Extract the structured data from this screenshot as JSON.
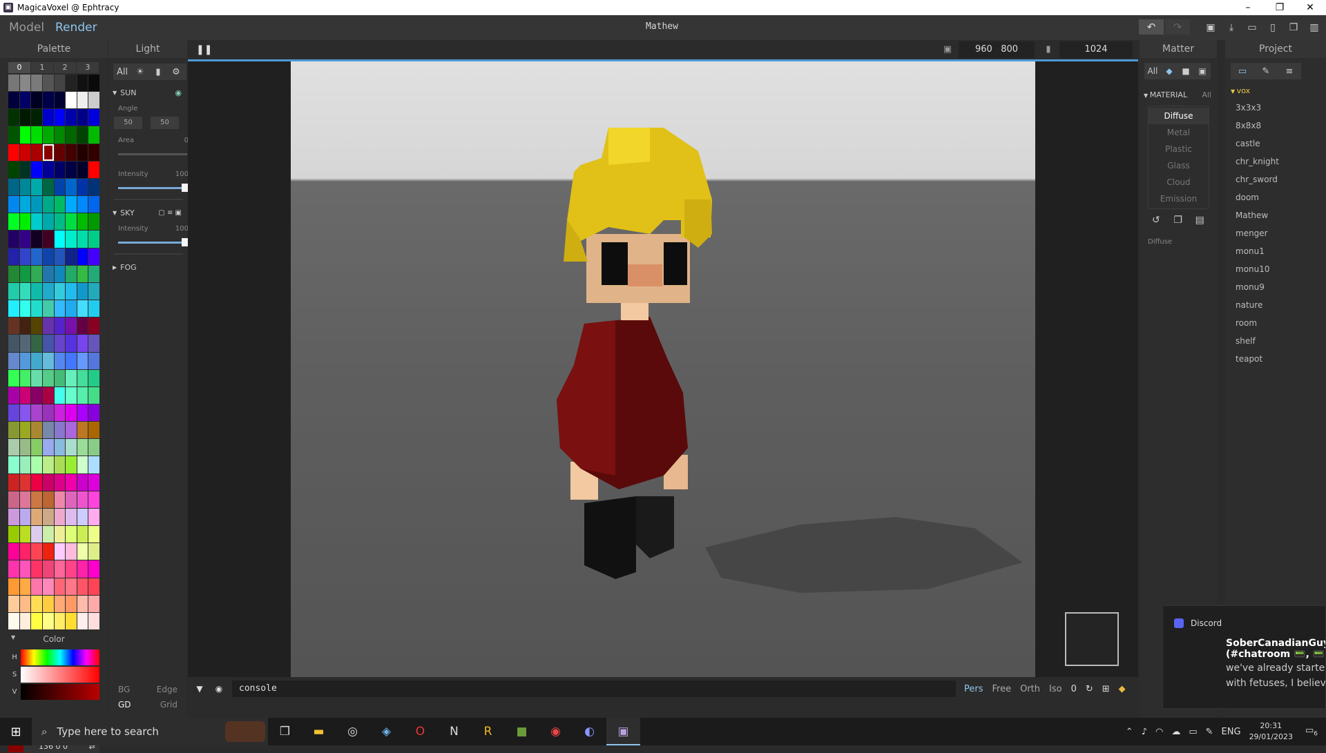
{
  "window": {
    "title": "MagicaVoxel @ Ephtracy",
    "app_icon": "magicavoxel-icon",
    "minimize": "–",
    "maximize": "❐",
    "close": "✕"
  },
  "menu": {
    "model": "Model",
    "render": "Render",
    "document_title": "Mathew"
  },
  "history": {
    "undo": "↶",
    "redo": "↷"
  },
  "palette": {
    "title": "Palette",
    "tabs": [
      "0",
      "1",
      "2",
      "3"
    ],
    "colors": [
      "#777777",
      "#888888",
      "#7a7a7a",
      "#555555",
      "#444444",
      "#222222",
      "#111111",
      "#0a0a0a",
      "#00003a",
      "#000066",
      "#000022",
      "#00004a",
      "#000033",
      "#ffffff",
      "#eeeeee",
      "#cccccc",
      "#003300",
      "#001a00",
      "#002200",
      "#0000cc",
      "#0000ff",
      "#0000aa",
      "#000088",
      "#0000dd",
      "#005500",
      "#00ff00",
      "#00dd00",
      "#00aa00",
      "#008800",
      "#006600",
      "#004400",
      "#00bb00",
      "#ff0000",
      "#cc0000",
      "#aa0000",
      "#880000",
      "#660000",
      "#440000",
      "#220000",
      "#330000",
      "#004400",
      "#003322",
      "#0000ff",
      "#000099",
      "#000066",
      "#000044",
      "#00002a",
      "#ff0000",
      "#006688",
      "#008899",
      "#00aaaa",
      "#006644",
      "#0044aa",
      "#0066cc",
      "#0033aa",
      "#003377",
      "#0088ee",
      "#00aadd",
      "#0099bb",
      "#00aa88",
      "#00bb66",
      "#00aaff",
      "#0088ff",
      "#0066ee",
      "#00ff22",
      "#00ee00",
      "#00cccc",
      "#00aaaa",
      "#00bb88",
      "#00dd44",
      "#00bb00",
      "#009900",
      "#220066",
      "#330088",
      "#110022",
      "#440022",
      "#00ffff",
      "#00eecc",
      "#00ddaa",
      "#00cc88",
      "#2222aa",
      "#3344cc",
      "#2266cc",
      "#1144aa",
      "#2255bb",
      "#112288",
      "#0000ff",
      "#4400ff",
      "#228833",
      "#119944",
      "#33aa55",
      "#2277aa",
      "#1188bb",
      "#22aa66",
      "#33bb44",
      "#22aa77",
      "#22ccaa",
      "#33ddbb",
      "#11bbaa",
      "#22aacc",
      "#33ccdd",
      "#22bbee",
      "#1199cc",
      "#22aabb",
      "#22eeff",
      "#33ffee",
      "#22ddcc",
      "#44ccaa",
      "#33bbff",
      "#22aaee",
      "#44ddff",
      "#22ccee",
      "#663322",
      "#442211",
      "#554400",
      "#6633aa",
      "#5522cc",
      "#7711aa",
      "#660044",
      "#880022",
      "#445566",
      "#556677",
      "#336644",
      "#4455aa",
      "#6644cc",
      "#5533dd",
      "#7744ee",
      "#6655bb",
      "#6688cc",
      "#5599dd",
      "#44aacc",
      "#66bbdd",
      "#5588ee",
      "#4477ff",
      "#6699ff",
      "#5577dd",
      "#33ff55",
      "#44ee66",
      "#66ddaa",
      "#55cc88",
      "#44bb77",
      "#66eebb",
      "#44dd99",
      "#22cc88",
      "#aa00aa",
      "#cc0077",
      "#880066",
      "#aa0044",
      "#44ffee",
      "#66ffcc",
      "#55eeaa",
      "#44dd88",
      "#6644dd",
      "#8855ee",
      "#aa44cc",
      "#9933bb",
      "#cc22dd",
      "#dd00ee",
      "#aa00ff",
      "#8800dd",
      "#889933",
      "#99aa22",
      "#aa8833",
      "#7788aa",
      "#8877cc",
      "#aa66dd",
      "#bb7722",
      "#aa6600",
      "#aaccaa",
      "#99bb88",
      "#88cc66",
      "#99aaee",
      "#88bbdd",
      "#aaddcc",
      "#99dd99",
      "#88cc88",
      "#88ffcc",
      "#99eebb",
      "#aaffaa",
      "#bbee88",
      "#aadd55",
      "#99ee33",
      "#ccffcc",
      "#aaddff",
      "#cc2222",
      "#dd3333",
      "#ee0044",
      "#cc0066",
      "#dd0088",
      "#ee00aa",
      "#cc00cc",
      "#dd00dd",
      "#cc6688",
      "#dd7799",
      "#cc7744",
      "#bb6633",
      "#ee88aa",
      "#dd66bb",
      "#ee55cc",
      "#ff44dd",
      "#cc99dd",
      "#bbaaee",
      "#ddaa77",
      "#ccaa88",
      "#eeaacc",
      "#ddbbee",
      "#ccccff",
      "#ffaaee",
      "#99cc00",
      "#bbdd22",
      "#ddccee",
      "#cceeaa",
      "#eeee99",
      "#ddff77",
      "#ccee55",
      "#eeff88",
      "#ff0099",
      "#ff2266",
      "#ff4455",
      "#ee2211",
      "#ffccff",
      "#ffbbdd",
      "#eeffaa",
      "#ddee88",
      "#ff33aa",
      "#ff55bb",
      "#ff3366",
      "#ee4477",
      "#ff6699",
      "#ff4488",
      "#ff22aa",
      "#ff00cc",
      "#ff9933",
      "#ffaa44",
      "#ff77aa",
      "#ff88bb",
      "#ff6677",
      "#ff7788",
      "#ff5566",
      "#ff4455",
      "#ffcc99",
      "#ffbb88",
      "#ffdd55",
      "#ffcc44",
      "#ffaa77",
      "#ff9966",
      "#ffbbaa",
      "#ffaaaa",
      "#fffaee",
      "#ffeedd",
      "#ffff44",
      "#ffff88",
      "#ffee66",
      "#ffdd33",
      "#ffeeee",
      "#ffdddd"
    ],
    "selected_index": 35
  },
  "color": {
    "title": "Color",
    "h": "H",
    "s": "S",
    "v": "V",
    "value": "136 0 0",
    "swap": "⇄"
  },
  "light": {
    "title": "Light",
    "icons": [
      "All",
      "☀",
      "▮",
      "⚙"
    ],
    "sun": {
      "label": "SUN",
      "angle_label": "Angle",
      "angle": [
        "50",
        "50"
      ],
      "area_label": "Area",
      "area": "0",
      "intensity_label": "Intensity",
      "intensity": "100"
    },
    "sky": {
      "label": "SKY",
      "intensity_label": "Intensity",
      "intensity": "100"
    },
    "fog": {
      "label": "FOG"
    }
  },
  "viewport": {
    "pause": "❚❚",
    "width": "960",
    "height": "800",
    "samples": "1024",
    "console_placeholder": "console",
    "views": [
      "Pers",
      "Free",
      "Orth",
      "Iso"
    ],
    "view_value": "0"
  },
  "bottom": {
    "bg": "BG",
    "edge": "Edge",
    "gd": "GD",
    "grid": "Grid"
  },
  "matter": {
    "title": "Matter",
    "icons": [
      "All",
      "◆",
      "■",
      "▣"
    ],
    "material_label": "MATERIAL",
    "material_filter": "All",
    "items": [
      "Diffuse",
      "Metal",
      "Plastic",
      "Glass",
      "Cloud",
      "Emission"
    ],
    "selected": "Diffuse",
    "sub_label": "Diffuse"
  },
  "project": {
    "title": "Project",
    "folder": "vox",
    "files": [
      "3x3x3",
      "8x8x8",
      "castle",
      "chr_knight",
      "chr_sword",
      "doom",
      "Mathew",
      "menger",
      "monu1",
      "monu10",
      "monu9",
      "nature",
      "room",
      "shelf",
      "teapot"
    ]
  },
  "toast": {
    "app": "Discord",
    "title": "SoberCanadianGuy (C",
    "line1": "(#chatroom 📟, 📟 Ma",
    "line2": "we've already started c",
    "line3": "with fetuses, I believe"
  },
  "taskbar": {
    "search_placeholder": "Type here to search",
    "lang": "ENG",
    "time": "20:31",
    "date": "29/01/2023",
    "notif_count": "6"
  },
  "colors": {
    "accent": "#8ec5ee",
    "panel": "#2d2d2d",
    "selected_color": "#880000"
  }
}
